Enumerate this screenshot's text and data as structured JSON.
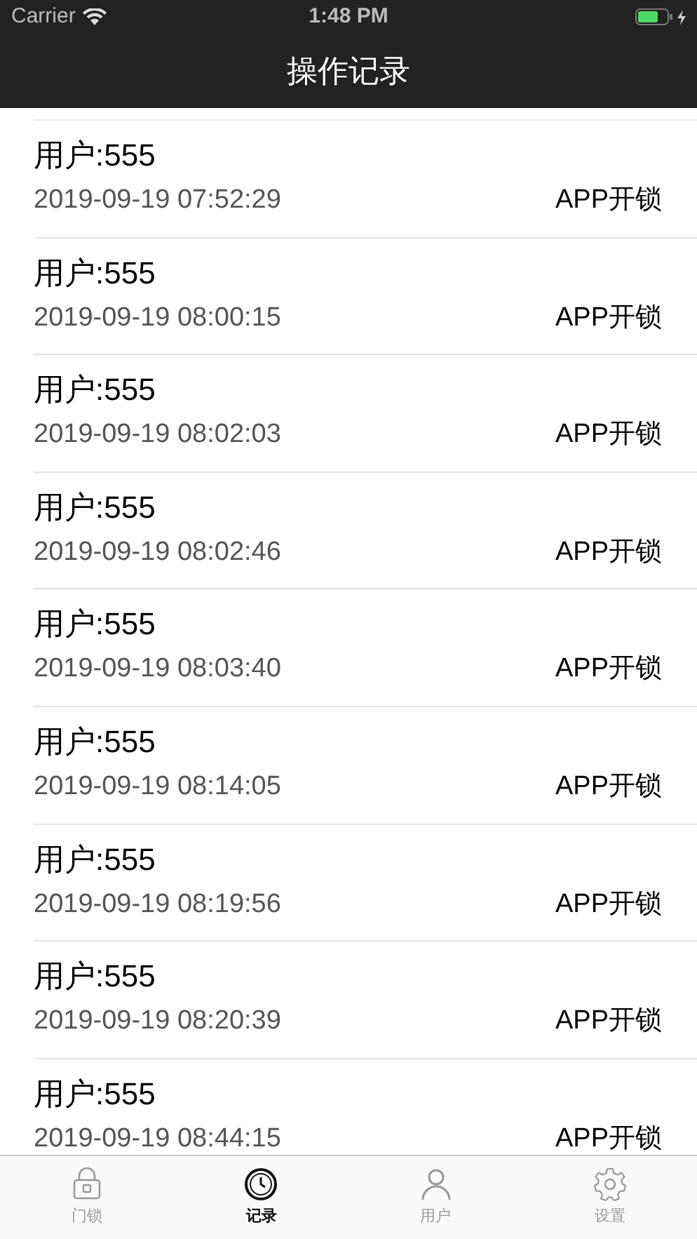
{
  "status_bar": {
    "carrier": "Carrier",
    "time": "1:48 PM",
    "battery_charging": true
  },
  "nav_bar": {
    "title": "操作记录"
  },
  "records": [
    {
      "user": "用户:555",
      "time": "2019-09-19 07:52:29",
      "action": "APP开锁"
    },
    {
      "user": "用户:555",
      "time": "2019-09-19 08:00:15",
      "action": "APP开锁"
    },
    {
      "user": "用户:555",
      "time": "2019-09-19 08:02:03",
      "action": "APP开锁"
    },
    {
      "user": "用户:555",
      "time": "2019-09-19 08:02:46",
      "action": "APP开锁"
    },
    {
      "user": "用户:555",
      "time": "2019-09-19 08:03:40",
      "action": "APP开锁"
    },
    {
      "user": "用户:555",
      "time": "2019-09-19 08:14:05",
      "action": "APP开锁"
    },
    {
      "user": "用户:555",
      "time": "2019-09-19 08:19:56",
      "action": "APP开锁"
    },
    {
      "user": "用户:555",
      "time": "2019-09-19 08:20:39",
      "action": "APP开锁"
    },
    {
      "user": "用户:555",
      "time": "2019-09-19 08:44:15",
      "action": "APP开锁"
    }
  ],
  "tab_bar": [
    {
      "kind": "lock",
      "label": "门锁",
      "selected": false
    },
    {
      "kind": "clock",
      "label": "记录",
      "selected": true
    },
    {
      "kind": "person",
      "label": "用户",
      "selected": false
    },
    {
      "kind": "gear",
      "label": "设置",
      "selected": false
    }
  ]
}
